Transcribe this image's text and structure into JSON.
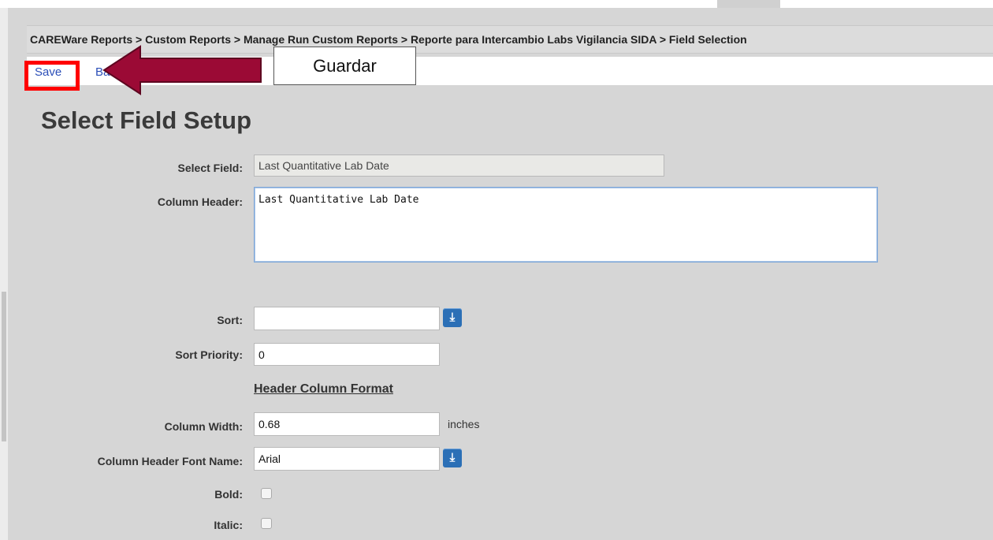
{
  "breadcrumb": {
    "text": "CAREWare Reports > Custom Reports > Manage Run Custom Reports > Reporte para Intercambio Labs Vigilancia SIDA > Field Selection"
  },
  "toolbar": {
    "save_label": "Save",
    "back_label": "Back"
  },
  "annotation": {
    "callout_text": "Guardar",
    "highlight_color": "#ff0000",
    "arrow_color": "#9b0a35"
  },
  "page_title": "Select Field Setup",
  "form": {
    "select_field": {
      "label": "Select Field:",
      "value": "Last Quantitative Lab Date"
    },
    "column_header": {
      "label": "Column Header:",
      "value": "Last Quantitative Lab Date"
    },
    "sort": {
      "label": "Sort:",
      "value": ""
    },
    "sort_priority": {
      "label": "Sort Priority:",
      "value": "0"
    },
    "section_heading": "Header Column Format",
    "column_width": {
      "label": "Column Width:",
      "value": "0.68",
      "unit": "inches"
    },
    "font_name": {
      "label": "Column Header Font Name:",
      "value": "Arial"
    },
    "bold": {
      "label": "Bold:",
      "checked": false
    },
    "italic": {
      "label": "Italic:",
      "checked": false
    }
  },
  "icons": {
    "dropdown": "download-arrow-icon"
  },
  "colors": {
    "link": "#2c4fb8",
    "dropdown_button": "#2b6fb6",
    "background": "#d6d6d6"
  }
}
